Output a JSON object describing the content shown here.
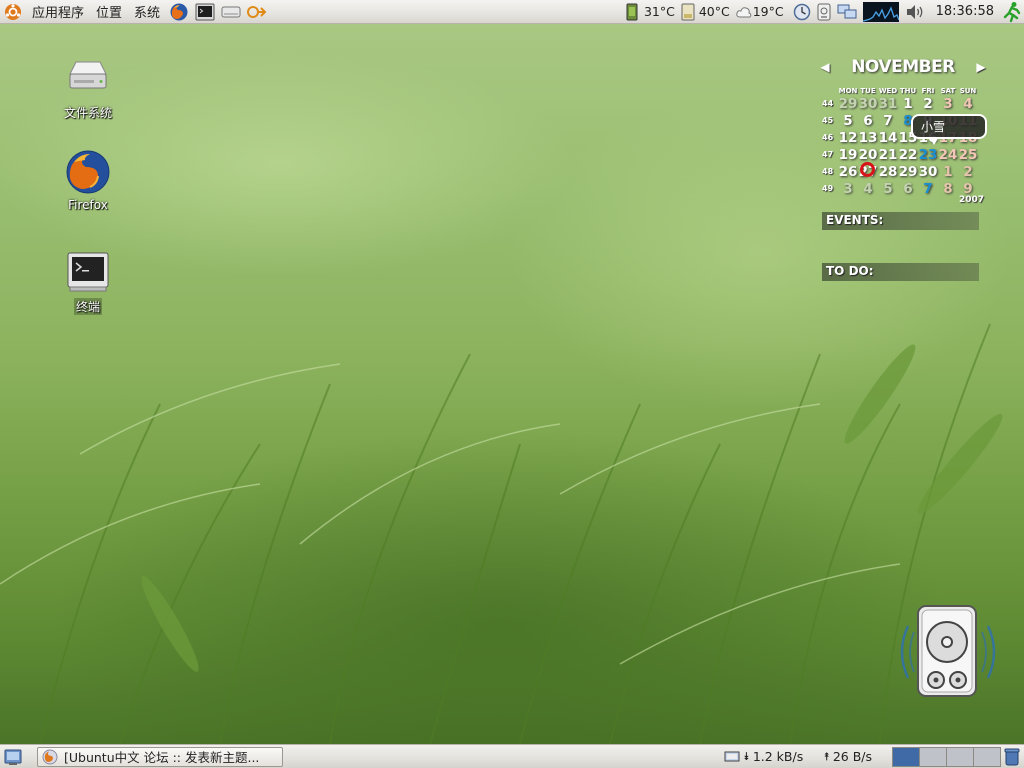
{
  "top_panel": {
    "menus": [
      "应用程序",
      "位置",
      "系统"
    ],
    "launchers": [
      "firefox-icon",
      "terminal-icon",
      "drive-icon",
      "network-arrow-icon"
    ],
    "tray": {
      "cpu_temp": "31°C",
      "hdd_temp": "40°C",
      "weather_temp": "19°C",
      "clock": "18:36:58"
    }
  },
  "desktop_icons": [
    {
      "label": "文件系统",
      "icon": "drive-icon"
    },
    {
      "label": "Firefox",
      "icon": "firefox-icon"
    },
    {
      "label": "终端",
      "icon": "terminal-icon"
    }
  ],
  "calendar": {
    "month": "NOVEMBER",
    "year": "2007",
    "day_names": [
      "MON",
      "TUE",
      "WED",
      "THU",
      "FRI",
      "SAT",
      "SUN"
    ],
    "weeks": [
      {
        "num": "44",
        "days": [
          "29",
          "30",
          "31",
          "1",
          "2",
          "3",
          "4"
        ]
      },
      {
        "num": "45",
        "days": [
          "5",
          "6",
          "7",
          "8",
          "9",
          "10",
          "11"
        ]
      },
      {
        "num": "46",
        "days": [
          "12",
          "13",
          "14",
          "15",
          "16",
          "17",
          "18"
        ]
      },
      {
        "num": "47",
        "days": [
          "19",
          "20",
          "21",
          "22",
          "23",
          "24",
          "25"
        ]
      },
      {
        "num": "48",
        "days": [
          "26",
          "27",
          "28",
          "29",
          "30",
          "1",
          "2"
        ]
      },
      {
        "num": "49",
        "days": [
          "3",
          "4",
          "5",
          "6",
          "7",
          "8",
          "9"
        ]
      }
    ],
    "today": "27",
    "tooltip": "小雪",
    "events_label": "EVENTS:",
    "todo_label": "TO DO:"
  },
  "bottom_panel": {
    "task": "[Ubuntu中文 论坛 :: 发表新主题...",
    "download_speed": "1.2 kB/s",
    "upload_speed": "26 B/s",
    "workspaces": 4,
    "active_workspace": 1
  },
  "colors": {
    "calendar_today_ring": "#d8141b",
    "calendar_blue_day": "#1b8fd1",
    "active_workspace": "#3f6aa6"
  }
}
